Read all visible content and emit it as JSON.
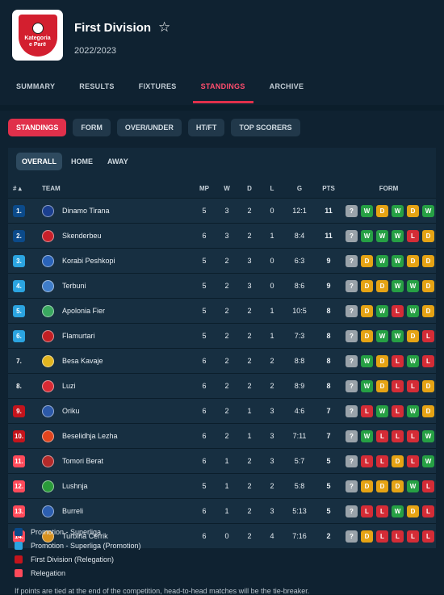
{
  "header": {
    "logo_lines": [
      "Kategoria",
      "e Parë"
    ],
    "title": "First Division",
    "season": "2022/2023",
    "star": "☆"
  },
  "tabs": [
    "SUMMARY",
    "RESULTS",
    "FIXTURES",
    "STANDINGS",
    "ARCHIVE"
  ],
  "active_tab": "STANDINGS",
  "pills": [
    "STANDINGS",
    "FORM",
    "OVER/UNDER",
    "HT/FT",
    "TOP SCORERS"
  ],
  "active_pill": "STANDINGS",
  "subtabs": [
    "OVERALL",
    "HOME",
    "AWAY"
  ],
  "active_subtab": "OVERALL",
  "columns": {
    "rank": "#",
    "team": "TEAM",
    "mp": "MP",
    "w": "W",
    "d": "D",
    "l": "L",
    "g": "G",
    "pts": "PTS",
    "form": "FORM"
  },
  "colors": {
    "promotion": "#0b4a8a",
    "promotion_playoff": "#2ba4e0",
    "relegation_playoff": "#c4141c",
    "relegation": "#ff4a5a",
    "win": "#26a044",
    "draw": "#e5a314",
    "loss": "#d42c36",
    "unknown": "#9aa3aa",
    "accent": "#e0304b"
  },
  "rows": [
    {
      "rank": "1.",
      "zone": "promotion",
      "team": "Dinamo Tirana",
      "mp": "5",
      "w": "3",
      "d": "2",
      "l": "0",
      "g": "12:1",
      "pts": "11",
      "form": [
        "?",
        "W",
        "D",
        "W",
        "D",
        "W"
      ],
      "crest": "#1b3f8f"
    },
    {
      "rank": "2.",
      "zone": "promotion",
      "team": "Skenderbeu",
      "mp": "6",
      "w": "3",
      "d": "2",
      "l": "1",
      "g": "8:4",
      "pts": "11",
      "form": [
        "?",
        "W",
        "W",
        "W",
        "L",
        "D"
      ],
      "crest": "#c8202a"
    },
    {
      "rank": "3.",
      "zone": "promotion_playoff",
      "team": "Korabi Peshkopi",
      "mp": "5",
      "w": "2",
      "d": "3",
      "l": "0",
      "g": "6:3",
      "pts": "9",
      "form": [
        "?",
        "D",
        "W",
        "W",
        "D",
        "D"
      ],
      "crest": "#2a63b8"
    },
    {
      "rank": "4.",
      "zone": "promotion_playoff",
      "team": "Terbuni",
      "mp": "5",
      "w": "2",
      "d": "3",
      "l": "0",
      "g": "8:6",
      "pts": "9",
      "form": [
        "?",
        "D",
        "D",
        "W",
        "W",
        "D"
      ],
      "crest": "#3f7dc9"
    },
    {
      "rank": "5.",
      "zone": "promotion_playoff",
      "team": "Apolonia Fier",
      "mp": "5",
      "w": "2",
      "d": "2",
      "l": "1",
      "g": "10:5",
      "pts": "8",
      "form": [
        "?",
        "D",
        "W",
        "L",
        "W",
        "D"
      ],
      "crest": "#3aa860"
    },
    {
      "rank": "6.",
      "zone": "promotion_playoff",
      "team": "Flamurtari",
      "mp": "5",
      "w": "2",
      "d": "2",
      "l": "1",
      "g": "7:3",
      "pts": "8",
      "form": [
        "?",
        "D",
        "W",
        "W",
        "D",
        "L"
      ],
      "crest": "#c21f24"
    },
    {
      "rank": "7.",
      "zone": "none",
      "team": "Besa Kavaje",
      "mp": "6",
      "w": "2",
      "d": "2",
      "l": "2",
      "g": "8:8",
      "pts": "8",
      "form": [
        "?",
        "W",
        "D",
        "L",
        "W",
        "L"
      ],
      "crest": "#e2b520"
    },
    {
      "rank": "8.",
      "zone": "none",
      "team": "Luzi",
      "mp": "6",
      "w": "2",
      "d": "2",
      "l": "2",
      "g": "8:9",
      "pts": "8",
      "form": [
        "?",
        "W",
        "D",
        "L",
        "L",
        "D"
      ],
      "crest": "#d62a34"
    },
    {
      "rank": "9.",
      "zone": "relegation_playoff",
      "team": "Oriku",
      "mp": "6",
      "w": "2",
      "d": "1",
      "l": "3",
      "g": "4:6",
      "pts": "7",
      "form": [
        "?",
        "L",
        "W",
        "L",
        "W",
        "D"
      ],
      "crest": "#2c59a8"
    },
    {
      "rank": "10.",
      "zone": "relegation_playoff",
      "team": "Beselidhja Lezha",
      "mp": "6",
      "w": "2",
      "d": "1",
      "l": "3",
      "g": "7:11",
      "pts": "7",
      "form": [
        "?",
        "W",
        "L",
        "L",
        "L",
        "W"
      ],
      "crest": "#e0451f"
    },
    {
      "rank": "11.",
      "zone": "relegation",
      "team": "Tomori Berat",
      "mp": "6",
      "w": "1",
      "d": "2",
      "l": "3",
      "g": "5:7",
      "pts": "5",
      "form": [
        "?",
        "L",
        "L",
        "D",
        "L",
        "W"
      ],
      "crest": "#b42a2a"
    },
    {
      "rank": "12.",
      "zone": "relegation",
      "team": "Lushnja",
      "mp": "5",
      "w": "1",
      "d": "2",
      "l": "2",
      "g": "5:8",
      "pts": "5",
      "form": [
        "?",
        "D",
        "D",
        "D",
        "W",
        "L"
      ],
      "crest": "#2a9a3a"
    },
    {
      "rank": "13.",
      "zone": "relegation",
      "team": "Burreli",
      "mp": "6",
      "w": "1",
      "d": "2",
      "l": "3",
      "g": "5:13",
      "pts": "5",
      "form": [
        "?",
        "L",
        "L",
        "W",
        "D",
        "L"
      ],
      "crest": "#2d5fb0"
    },
    {
      "rank": "14.",
      "zone": "relegation",
      "team": "Turbina Cerrik",
      "mp": "6",
      "w": "0",
      "d": "2",
      "l": "4",
      "g": "7:16",
      "pts": "2",
      "form": [
        "?",
        "D",
        "L",
        "L",
        "L",
        "L"
      ],
      "crest": "#d8911e"
    }
  ],
  "legend": [
    {
      "label": "Promotion - Superliga",
      "zone": "promotion"
    },
    {
      "label": "Promotion - Superliga (Promotion)",
      "zone": "promotion_playoff"
    },
    {
      "label": "First Division (Relegation)",
      "zone": "relegation_playoff"
    },
    {
      "label": "Relegation",
      "zone": "relegation"
    }
  ],
  "footnote": "If points are tied at the end of the competition, head-to-head matches will be the tie-breaker."
}
